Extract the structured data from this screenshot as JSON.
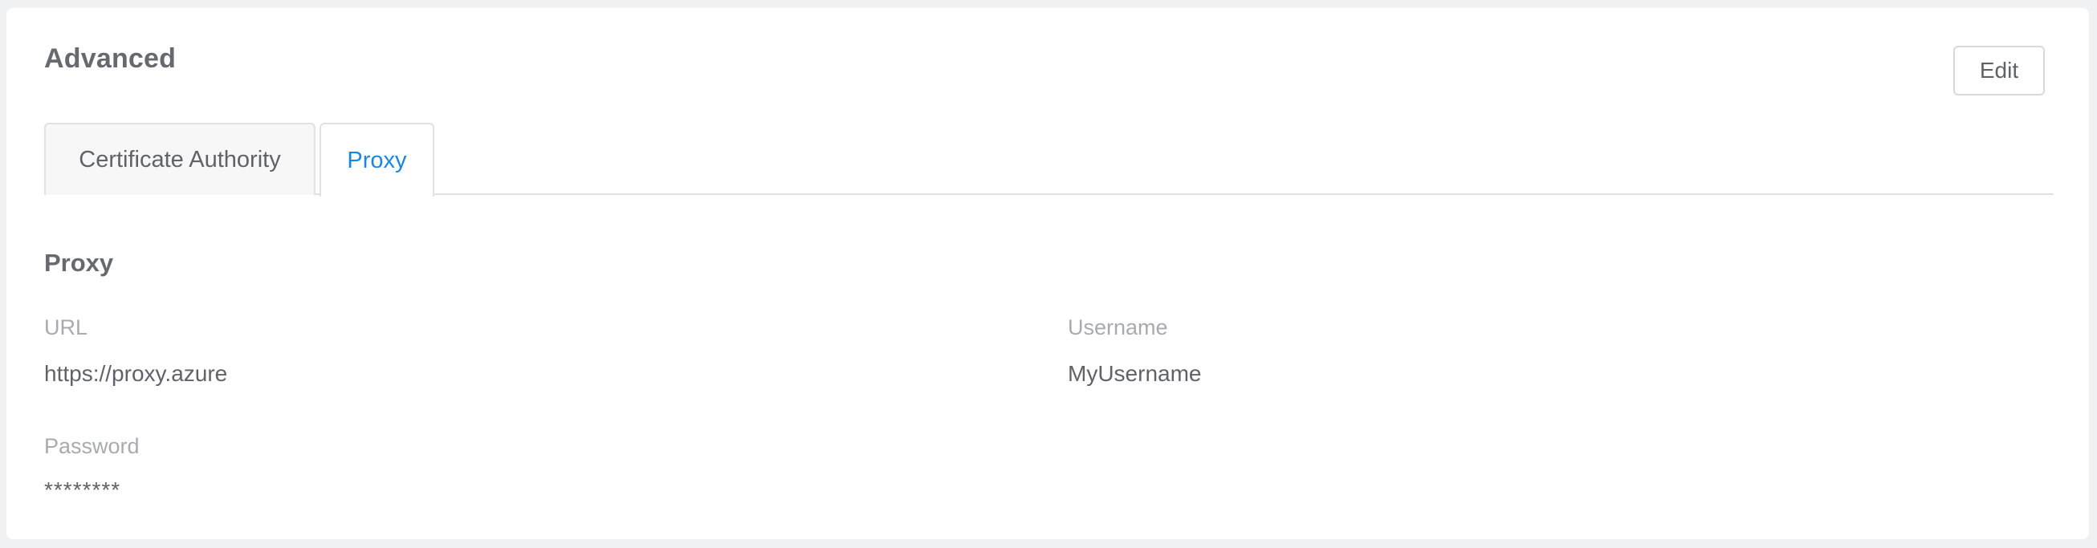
{
  "section": {
    "title": "Advanced",
    "edit_label": "Edit"
  },
  "tabs": [
    {
      "label": "Certificate Authority",
      "active": false
    },
    {
      "label": "Proxy",
      "active": true
    }
  ],
  "proxy": {
    "title": "Proxy",
    "fields": {
      "url": {
        "label": "URL",
        "value": "https://proxy.azure"
      },
      "username": {
        "label": "Username",
        "value": "MyUsername"
      },
      "password": {
        "label": "Password",
        "value": "********"
      }
    }
  },
  "colors": {
    "accent": "#1a86e0",
    "label": "#a7abb0",
    "text": "#5f6368",
    "background": "#f0f1f3"
  }
}
